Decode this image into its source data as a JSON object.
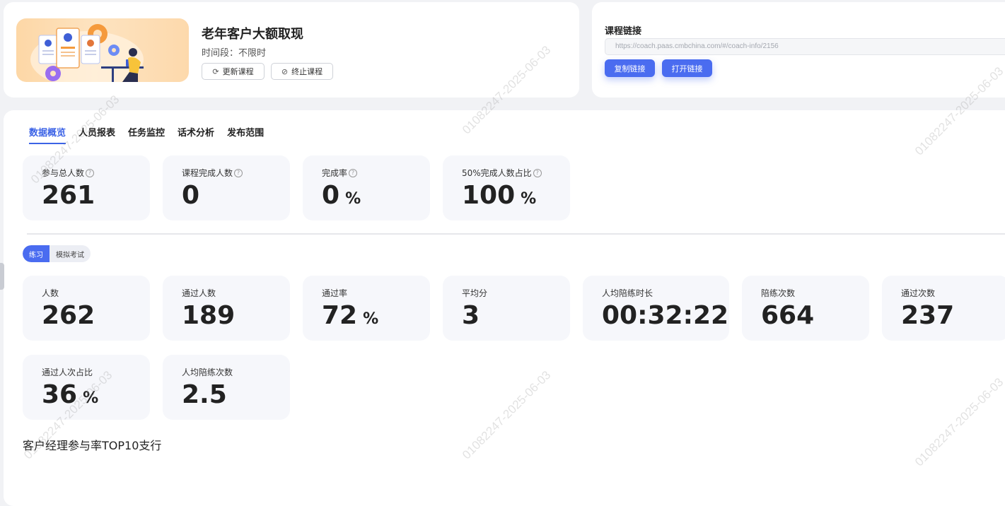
{
  "course": {
    "title": "老年客户大额取现",
    "period": "时间段：不限时",
    "refresh_label": "更新课程",
    "stop_label": "终止课程"
  },
  "link": {
    "label": "课程链接",
    "url": "https://coach.paas.cmbchina.com/#/coach-info/2156",
    "copy_label": "复制链接",
    "open_label": "打开链接"
  },
  "tabs": [
    "数据概览",
    "人员报表",
    "任务监控",
    "话术分析",
    "发布范围"
  ],
  "overview": [
    {
      "label": "参与总人数",
      "value": "261",
      "unit": ""
    },
    {
      "label": "课程完成人数",
      "value": "0",
      "unit": ""
    },
    {
      "label": "完成率",
      "value": "0",
      "unit": "%"
    },
    {
      "label": "50%完成人数占比",
      "value": "100",
      "unit": "%"
    }
  ],
  "segment": [
    "练习",
    "模拟考试"
  ],
  "practice": [
    {
      "label": "人数",
      "value": "262",
      "unit": ""
    },
    {
      "label": "通过人数",
      "value": "189",
      "unit": ""
    },
    {
      "label": "通过率",
      "value": "72",
      "unit": "%"
    },
    {
      "label": "平均分",
      "value": "3",
      "unit": ""
    },
    {
      "label": "人均陪练时长",
      "value": "00:32:22",
      "unit": ""
    },
    {
      "label": "陪练次数",
      "value": "664",
      "unit": ""
    },
    {
      "label": "通过次数",
      "value": "237",
      "unit": ""
    },
    {
      "label": "通过人次占比",
      "value": "36",
      "unit": "%"
    },
    {
      "label": "人均陪练次数",
      "value": "2.5",
      "unit": ""
    }
  ],
  "section_title": "客户经理参与率TOP10支行",
  "watermark": "01082247-2025-06-03"
}
